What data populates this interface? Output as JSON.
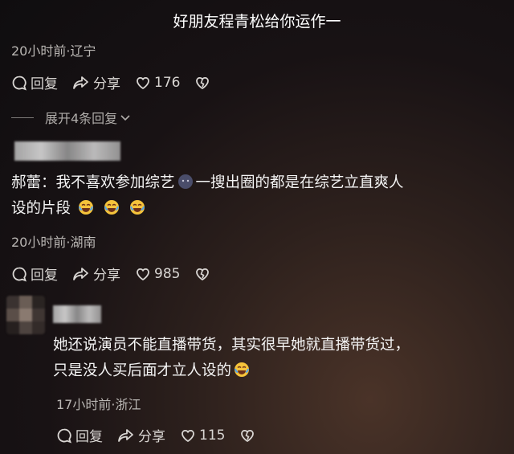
{
  "top_comment": {
    "text": "好朋友程青松给你运作一",
    "meta": "20小时前·辽宁",
    "reply_label": "回复",
    "share_label": "分享",
    "like_count": "176"
  },
  "expand_replies_label": "展开4条回复",
  "comments": [
    {
      "text_part1": "郝蕾：我不喜欢参加综艺",
      "text_part2": "一搜出圈的都是在综艺立直爽人",
      "text_part3": "设的片段",
      "meta": "20小时前·湖南",
      "reply_label": "回复",
      "share_label": "分享",
      "like_count": "985"
    },
    {
      "text_line1": "她还说演员不能直播带货，其实很早她就直播带货过，",
      "text_line2": "只是没人买后面才立人设的",
      "meta": "17小时前·浙江",
      "reply_label": "回复",
      "share_label": "分享",
      "like_count": "115"
    }
  ],
  "icons": [
    "comment-icon",
    "share-icon",
    "heart-icon",
    "broken-heart-icon",
    "chevron-down-icon",
    "laugh-cry-emoji",
    "face-emoji"
  ]
}
